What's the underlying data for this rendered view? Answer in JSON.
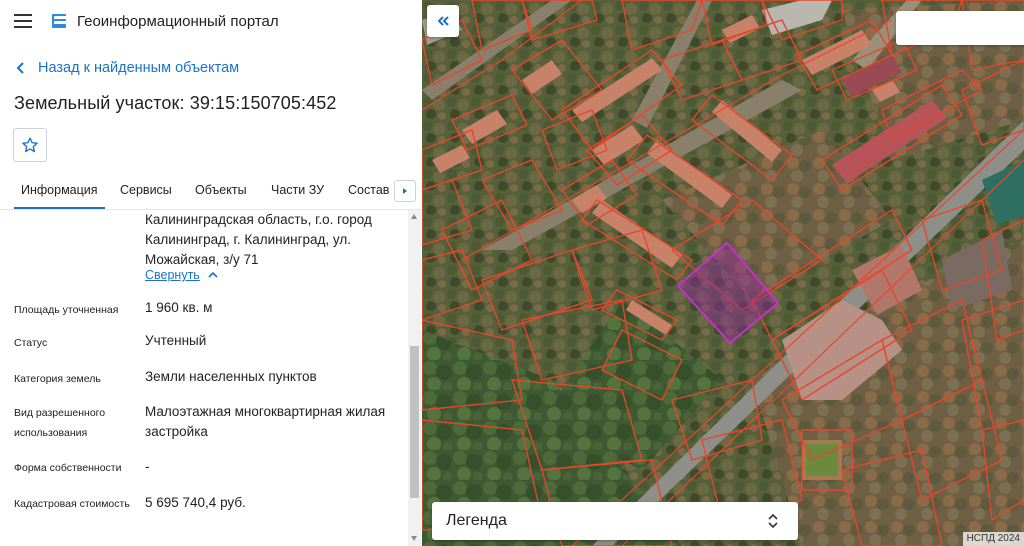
{
  "header": {
    "title": "Геоинформационный портал"
  },
  "back_link": {
    "label": "Назад к найденным объектам"
  },
  "object": {
    "title": "Земельный участок: 39:15:150705:452"
  },
  "tabs": [
    {
      "label": "Информация",
      "active": true
    },
    {
      "label": "Сервисы",
      "active": false
    },
    {
      "label": "Объекты",
      "active": false
    },
    {
      "label": "Части ЗУ",
      "active": false
    },
    {
      "label": "Состав",
      "active": false
    }
  ],
  "info": {
    "address": "Калининградская область, г.о. город Калининград, г. Калининград, ул. Можайская, з/у 71",
    "collapse_label": "Свернуть",
    "rows": [
      {
        "label": "Площадь уточненная",
        "value": "1 960 кв. м"
      },
      {
        "label": "Статус",
        "value": "Учтенный"
      },
      {
        "label": "Категория земель",
        "value": "Земли населенных пунктов"
      },
      {
        "label": "Вид разрешенного использования",
        "value": "Малоэтажная многоквартирная жилая застройка"
      },
      {
        "label": "Форма собственности",
        "value": "-"
      },
      {
        "label": "Кадастровая стоимость",
        "value": "5 695 740,4 руб."
      }
    ]
  },
  "map": {
    "legend_label": "Легенда",
    "attribution": "НСПД 2024",
    "parcel_outline_color": "#e8462a",
    "selected_parcel_color": "#c830c8"
  },
  "colors": {
    "accent": "#1a73c9"
  }
}
